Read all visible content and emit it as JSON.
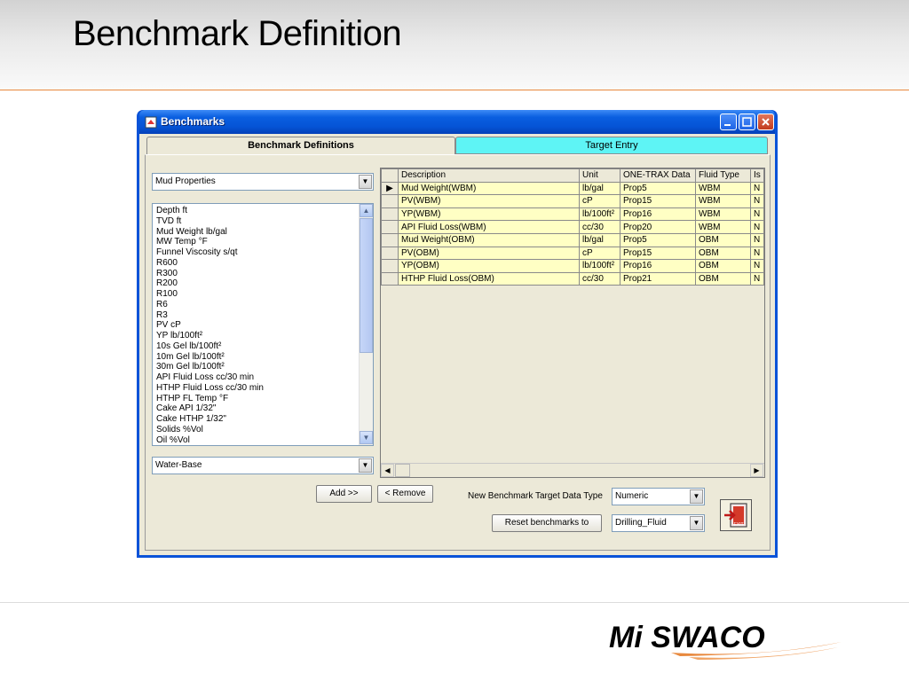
{
  "slide": {
    "title": "Benchmark Definition",
    "logo_text": "Mi SWACO"
  },
  "window": {
    "title": "Benchmarks",
    "tabs": [
      {
        "label": "Benchmark Definitions",
        "active": true,
        "color": "#ece9d8"
      },
      {
        "label": "Target Entry",
        "active": false,
        "color": "#5ef4f5"
      }
    ]
  },
  "left": {
    "category_combo": "Mud Properties",
    "properties": [
      "Depth  ft",
      "TVD  ft",
      "Mud Weight  lb/gal",
      "MW Temp  °F",
      "Funnel Viscosity  s/qt",
      "R600",
      "R300",
      "R200",
      "R100",
      "R6",
      "R3",
      "PV  cP",
      "YP  lb/100ft²",
      "10s Gel  lb/100ft²",
      "10m Gel  lb/100ft²",
      "30m Gel  lb/100ft²",
      "API Fluid Loss  cc/30 min",
      "HTHP Fluid Loss  cc/30 min",
      "HTHP FL Temp  °F",
      "Cake API  1/32\"",
      "Cake HTHP  1/32\"",
      "Solids  %Vol",
      "Oil  %Vol"
    ],
    "fluid_combo": "Water-Base"
  },
  "grid": {
    "columns": [
      "Description",
      "Unit",
      "ONE-TRAX Data",
      "Fluid Type",
      "Is"
    ],
    "rows": [
      [
        "Mud Weight(WBM)",
        "lb/gal",
        "Prop5",
        "WBM",
        "N"
      ],
      [
        "PV(WBM)",
        "cP",
        "Prop15",
        "WBM",
        "N"
      ],
      [
        "YP(WBM)",
        "lb/100ft²",
        "Prop16",
        "WBM",
        "N"
      ],
      [
        "API Fluid Loss(WBM)",
        "cc/30",
        "Prop20",
        "WBM",
        "N"
      ],
      [
        "Mud Weight(OBM)",
        "lb/gal",
        "Prop5",
        "OBM",
        "N"
      ],
      [
        "PV(OBM)",
        "cP",
        "Prop15",
        "OBM",
        "N"
      ],
      [
        "YP(OBM)",
        "lb/100ft²",
        "Prop16",
        "OBM",
        "N"
      ],
      [
        "HTHP Fluid Loss(OBM)",
        "cc/30",
        "Prop21",
        "OBM",
        "N"
      ]
    ],
    "current_row_marker": "▶"
  },
  "controls": {
    "add_label": "Add >>",
    "remove_label": "< Remove",
    "target_type_label": "New Benchmark Target Data Type",
    "target_type_value": "Numeric",
    "reset_label": "Reset benchmarks to",
    "reset_value": "Drilling_Fluid",
    "exit_label": "EXIT"
  },
  "colors": {
    "accent": "#e8893e",
    "titlebar": "#0554d6",
    "grid_cell": "#ffffc4",
    "tab_inactive": "#5ef4f5"
  }
}
